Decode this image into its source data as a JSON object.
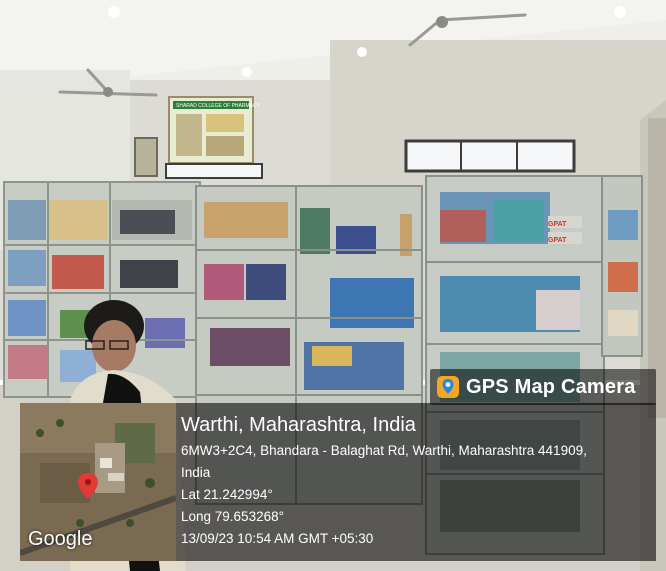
{
  "scene": {
    "description_colors": {
      "ceiling": "#f2f2ee",
      "wall": "#ddddd6",
      "cabinet": "#c9cfc8",
      "floor": "#d6d3cb"
    },
    "poster_title": "SHARAD COLLEGE OF PHARMACY",
    "book_labels": [
      "GPAT",
      "GPAT"
    ]
  },
  "camera_badge": {
    "label": "GPS Map Camera",
    "icon": "map-pin-camera-icon",
    "icon_color": "#f5a623"
  },
  "map": {
    "provider": "Google",
    "pin_color": "#e53935"
  },
  "location": {
    "title": "Warthi, Maharashtra, India",
    "address_line1": "6MW3+2C4, Bhandara - Balaghat Rd, Warthi, Maharashtra 441909,",
    "address_line2": "India",
    "lat": "Lat 21.242994°",
    "long": "Long 79.653268°",
    "timestamp": "13/09/23 10:54 AM GMT +05:30"
  }
}
